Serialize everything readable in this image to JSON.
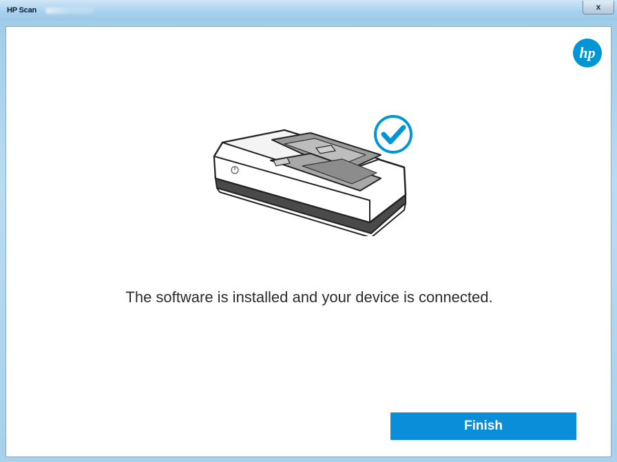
{
  "window": {
    "title": "HP Scan",
    "close_label": "x"
  },
  "content": {
    "logo_icon": "hp-logo-icon",
    "illustration_icon": "scanner-with-checkmark-icon",
    "message": "The software is installed and your device is connected.",
    "finish_label": "Finish"
  },
  "colors": {
    "brand_blue": "#0096D6",
    "button_blue": "#0A8ED9",
    "text": "#2B2B2B"
  }
}
